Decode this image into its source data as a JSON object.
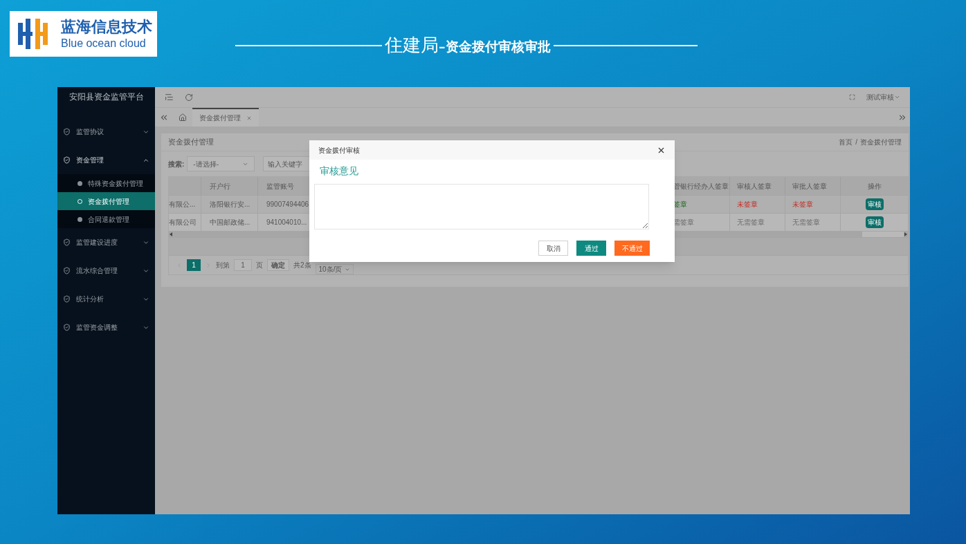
{
  "slide": {
    "logo": {
      "name": "蓝海信息技术",
      "tagline": "Blue ocean cloud"
    },
    "title_parts": [
      "住建局",
      "–资金拨付审核审批"
    ]
  },
  "app": {
    "brand": "安阳县资金监管平台",
    "menu": [
      {
        "label": "监管协议",
        "expanded": false,
        "selected": false
      },
      {
        "label": "资金管理",
        "expanded": true,
        "selected": false,
        "children": [
          {
            "label": "特殊资金拨付管理",
            "selected": false
          },
          {
            "label": "资金拨付管理",
            "selected": true
          },
          {
            "label": "合同退款管理",
            "selected": false
          }
        ]
      },
      {
        "label": "监管建设进度",
        "expanded": false,
        "selected": false
      },
      {
        "label": "流水综合管理",
        "expanded": false,
        "selected": false
      },
      {
        "label": "统计分析",
        "expanded": false,
        "selected": false
      },
      {
        "label": "监管资金调整",
        "expanded": false,
        "selected": false
      }
    ],
    "user": "测试审核",
    "tabs": [
      {
        "label": "资金拨付管理",
        "selected": true
      }
    ],
    "page_title": "资金拨付管理",
    "breadcrumb": [
      "首页",
      "资金拨付管理"
    ],
    "breadcrumb_separator": "/",
    "search": {
      "label": "搜索:",
      "select_placeholder": "-请选择-",
      "keyword_placeholder": "输入关键字"
    },
    "table": {
      "left_columns": [
        "开户行",
        "监管账号"
      ],
      "right_columns": [
        "管银行经办人签章",
        "审核人签章",
        "审批人签章",
        "操作"
      ],
      "rows": [
        {
          "left_cells": [
            "有限公...",
            "洛阳银行安...",
            "99007494406"
          ],
          "signatures": [
            {
              "text": "签章",
              "kind": "signed"
            },
            {
              "text": "未签章",
              "kind": "unsigned"
            },
            {
              "text": "未签章",
              "kind": "unsigned"
            }
          ],
          "action": "审核"
        },
        {
          "left_cells": [
            "有限公司",
            "中国邮政储...",
            "941004010..."
          ],
          "signatures": [
            {
              "text": "需签章",
              "kind": "not_required"
            },
            {
              "text": "无需签章",
              "kind": "not_required"
            },
            {
              "text": "无需签章",
              "kind": "not_required"
            }
          ],
          "action": "审核"
        }
      ]
    },
    "pagination": {
      "current": "1",
      "goto_label": "到第",
      "goto_value": "1",
      "page_label": "页",
      "confirm": "确定",
      "total": "共2条",
      "page_size": "10条/页"
    }
  },
  "dialog": {
    "title": "资金拨付审核",
    "heading": "审核意见",
    "buttons": [
      {
        "label": "取消",
        "kind": "cancel"
      },
      {
        "label": "通过",
        "kind": "primary"
      },
      {
        "label": "不通过",
        "kind": "danger"
      }
    ]
  }
}
